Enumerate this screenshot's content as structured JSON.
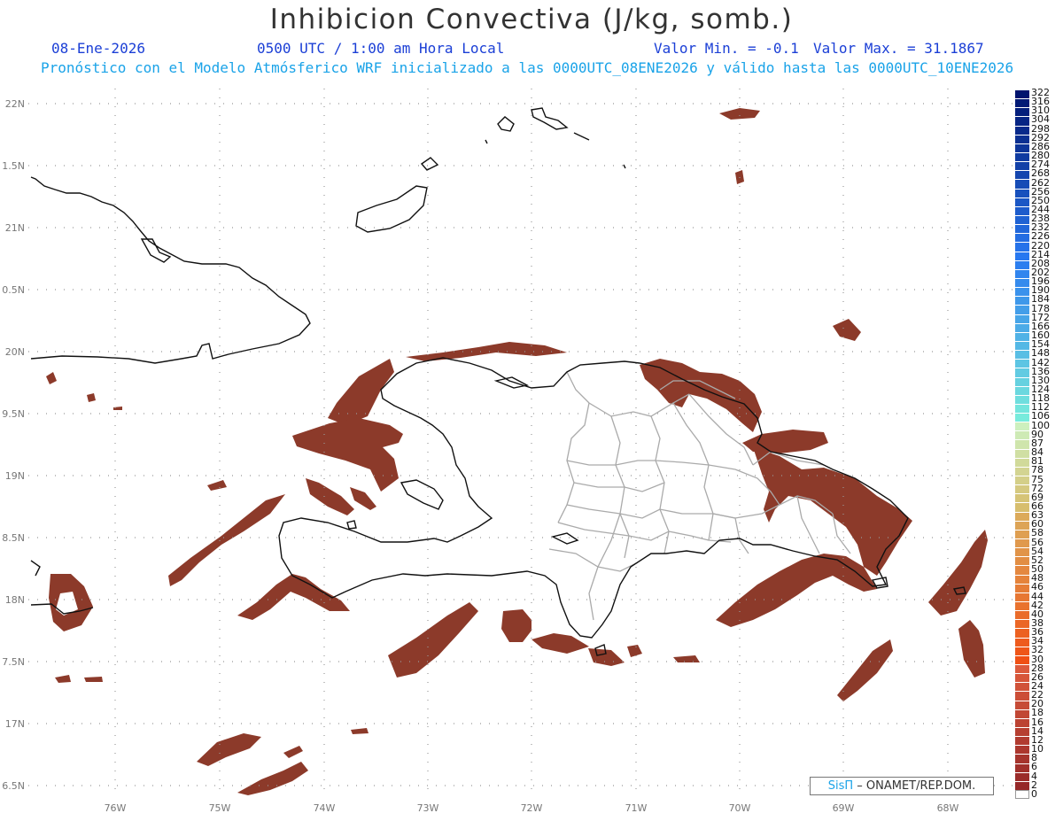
{
  "header": {
    "title": "Inhibicion Convectiva (J/kg, somb.)",
    "date": "08-Ene-2026",
    "time": "0500 UTC / 1:00 am Hora Local",
    "min_label": "Valor Min. = -0.1",
    "max_label": "Valor Max. = 31.1867",
    "subtitle": "Pronóstico con el Modelo Atmósferico WRF inicializado a las 0000UTC_08ENE2026 y válido hasta las  0000UTC_10ENE2026"
  },
  "axes": {
    "lat_labels": [
      "22N",
      "1.5N",
      "21N",
      "0.5N",
      "20N",
      "9.5N",
      "19N",
      "8.5N",
      "18N",
      "7.5N",
      "17N",
      "6.5N"
    ],
    "lon_labels": [
      "76W",
      "75W",
      "74W",
      "73W",
      "72W",
      "71W",
      "70W",
      "69W",
      "68W"
    ]
  },
  "colorbar": {
    "labels": [
      "322",
      "316",
      "310",
      "304",
      "298",
      "292",
      "286",
      "280",
      "274",
      "268",
      "262",
      "256",
      "250",
      "244",
      "238",
      "232",
      "226",
      "220",
      "214",
      "208",
      "202",
      "196",
      "190",
      "184",
      "178",
      "172",
      "166",
      "160",
      "154",
      "148",
      "142",
      "136",
      "130",
      "124",
      "118",
      "112",
      "106",
      "100",
      "90",
      "87",
      "84",
      "81",
      "78",
      "75",
      "72",
      "69",
      "66",
      "63",
      "60",
      "58",
      "56",
      "54",
      "52",
      "50",
      "48",
      "46",
      "44",
      "42",
      "40",
      "38",
      "36",
      "34",
      "32",
      "30",
      "28",
      "26",
      "24",
      "22",
      "20",
      "18",
      "16",
      "14",
      "12",
      "10",
      "8",
      "6",
      "4",
      "2",
      "0"
    ]
  },
  "credit": {
    "brand": "SisΠ",
    "text": "– ONAMET/REP.DOM."
  },
  "colors": {
    "cin_fill": "#8c3a2a",
    "cin_fill_light": "#a0452f",
    "coast": "#111111",
    "province": "#aaaaaa",
    "grid": "#999999",
    "blue_text": "#1b3fd6",
    "cyan_text": "#1aa3e8"
  }
}
